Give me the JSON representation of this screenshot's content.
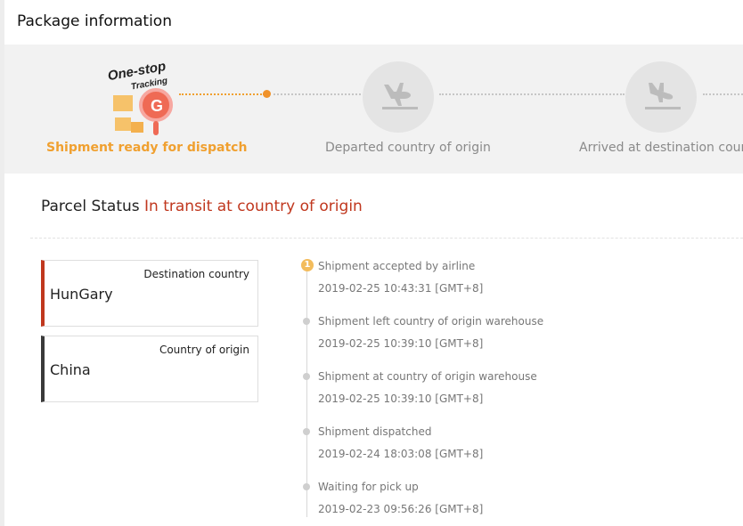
{
  "header": {
    "title": "Package information"
  },
  "logo": {
    "line1": "One-stop",
    "line2": "Tracking"
  },
  "stepper": {
    "steps": [
      {
        "label": "Shipment ready for dispatch",
        "state": "active"
      },
      {
        "label": "Departed country of origin",
        "state": "pending",
        "icon": "plane-takeoff-icon"
      },
      {
        "label": "Arrived at destination country",
        "state": "pending",
        "icon": "plane-landing-icon"
      }
    ]
  },
  "status": {
    "label": "Parcel Status",
    "value": "In transit at country of origin"
  },
  "countries": {
    "destination": {
      "label": "Destination country",
      "value": "HunGary"
    },
    "origin": {
      "label": "Country of origin",
      "value": "China"
    }
  },
  "timeline": {
    "latest_index": "1",
    "events": [
      {
        "title": "Shipment accepted by airline",
        "time": "2019-02-25 10:43:31 [GMT+8]"
      },
      {
        "title": "Shipment left country of origin warehouse",
        "time": "2019-02-25 10:39:10 [GMT+8]"
      },
      {
        "title": "Shipment at country of origin warehouse",
        "time": "2019-02-25 10:39:10 [GMT+8]"
      },
      {
        "title": "Shipment dispatched",
        "time": "2019-02-24 18:03:08 [GMT+8]"
      },
      {
        "title": "Waiting for pick up",
        "time": "2019-02-23 09:56:26 [GMT+8]"
      }
    ]
  },
  "colors": {
    "accent_orange": "#f0a030",
    "status_red": "#c0371e",
    "step_bg": "#f2f2f2"
  }
}
